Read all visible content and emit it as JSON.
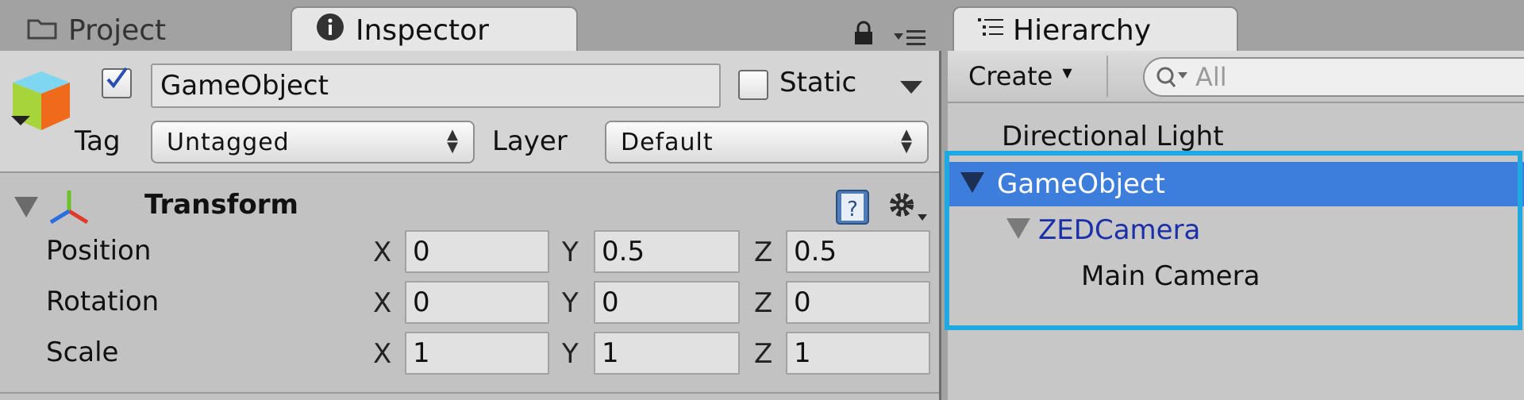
{
  "tabs": {
    "project": {
      "label": "Project",
      "icon": "folder-icon"
    },
    "inspector": {
      "label": "Inspector",
      "icon": "info-icon"
    },
    "hierarchy": {
      "label": "Hierarchy",
      "icon": "list-icon"
    }
  },
  "inspector": {
    "object_name": "GameObject",
    "active_checked": true,
    "static_label": "Static",
    "tag_label": "Tag",
    "tag_value": "Untagged",
    "layer_label": "Layer",
    "layer_value": "Default",
    "component": {
      "name": "Transform",
      "rows": [
        {
          "label": "Position",
          "x": "0",
          "y": "0.5",
          "z": "0.5"
        },
        {
          "label": "Rotation",
          "x": "0",
          "y": "0",
          "z": "0"
        },
        {
          "label": "Scale",
          "x": "1",
          "y": "1",
          "z": "1"
        }
      ],
      "axis_x": "X",
      "axis_y": "Y",
      "axis_z": "Z"
    }
  },
  "hierarchy": {
    "create_label": "Create",
    "search_placeholder": "All",
    "items": [
      {
        "label": "Directional Light",
        "depth": 0,
        "foldout": false,
        "selected": false,
        "prefab": false
      },
      {
        "label": "GameObject",
        "depth": 0,
        "foldout": true,
        "selected": true,
        "prefab": false
      },
      {
        "label": "ZEDCamera",
        "depth": 1,
        "foldout": true,
        "selected": false,
        "prefab": true
      },
      {
        "label": "Main Camera",
        "depth": 2,
        "foldout": false,
        "selected": false,
        "prefab": false
      }
    ]
  },
  "colors": {
    "selection": "#3d7ddb",
    "prefab_text": "#1a2fa8",
    "highlight_border": "#1fa9e1"
  }
}
